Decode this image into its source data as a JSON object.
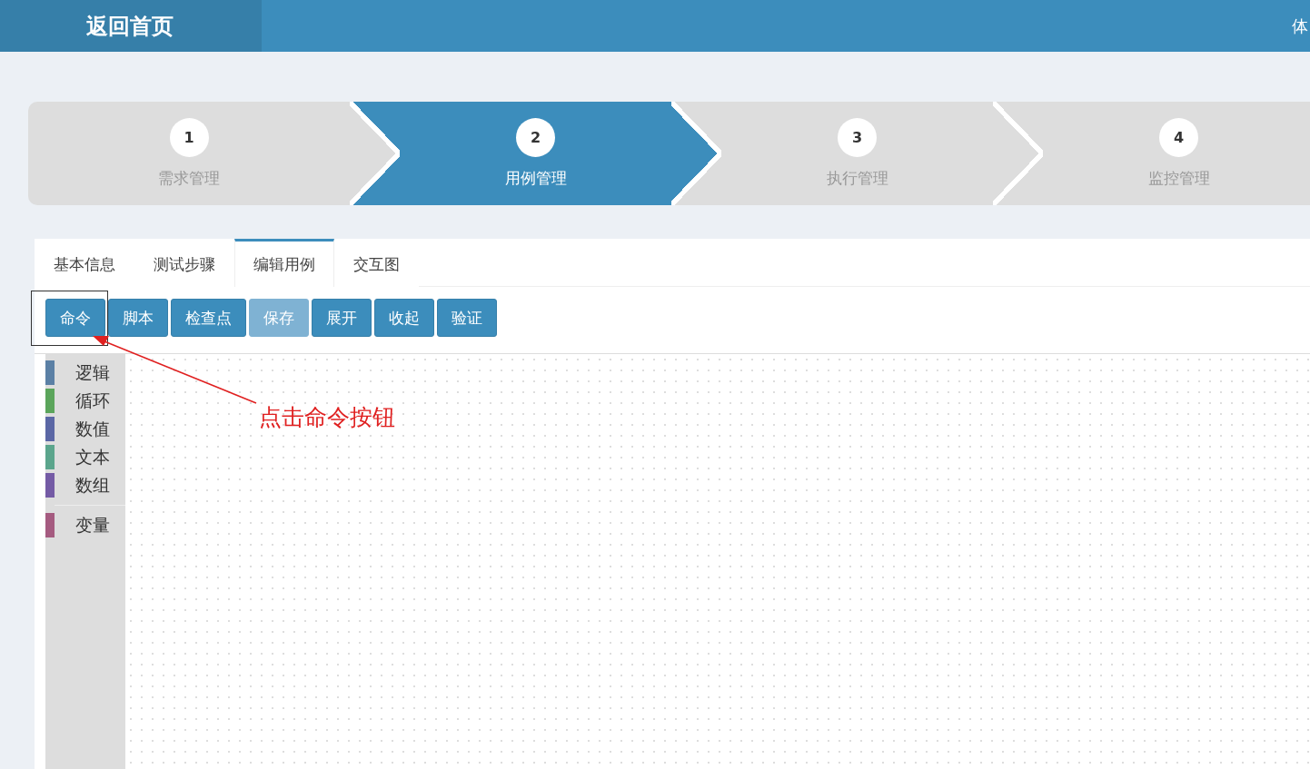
{
  "header": {
    "home_link": "返回首页",
    "user_text": "体"
  },
  "steps": [
    {
      "number": "1",
      "label": "需求管理",
      "selected": false
    },
    {
      "number": "2",
      "label": "用例管理",
      "selected": true
    },
    {
      "number": "3",
      "label": "执行管理",
      "selected": false
    },
    {
      "number": "4",
      "label": "监控管理",
      "selected": false
    }
  ],
  "tabs": [
    {
      "label": "基本信息",
      "selected": false
    },
    {
      "label": "测试步骤",
      "selected": false
    },
    {
      "label": "编辑用例",
      "selected": true
    },
    {
      "label": "交互图",
      "selected": false
    }
  ],
  "toolbar": [
    {
      "label": "命令",
      "disabled": false
    },
    {
      "label": "脚本",
      "disabled": false
    },
    {
      "label": "检查点",
      "disabled": false
    },
    {
      "label": "保存",
      "disabled": true
    },
    {
      "label": "展开",
      "disabled": false
    },
    {
      "label": "收起",
      "disabled": false
    },
    {
      "label": "验证",
      "disabled": false
    }
  ],
  "toolbox": {
    "categories": [
      {
        "label": "逻辑",
        "color": "#5b80a5"
      },
      {
        "label": "循环",
        "color": "#5ba55b"
      },
      {
        "label": "数值",
        "color": "#5b67a5"
      },
      {
        "label": "文本",
        "color": "#5ba58c"
      },
      {
        "label": "数组",
        "color": "#745ba5"
      }
    ],
    "variable_categories": [
      {
        "label": "变量",
        "color": "#a55b80"
      }
    ]
  },
  "annotation": {
    "text": "点击命令按钮"
  }
}
